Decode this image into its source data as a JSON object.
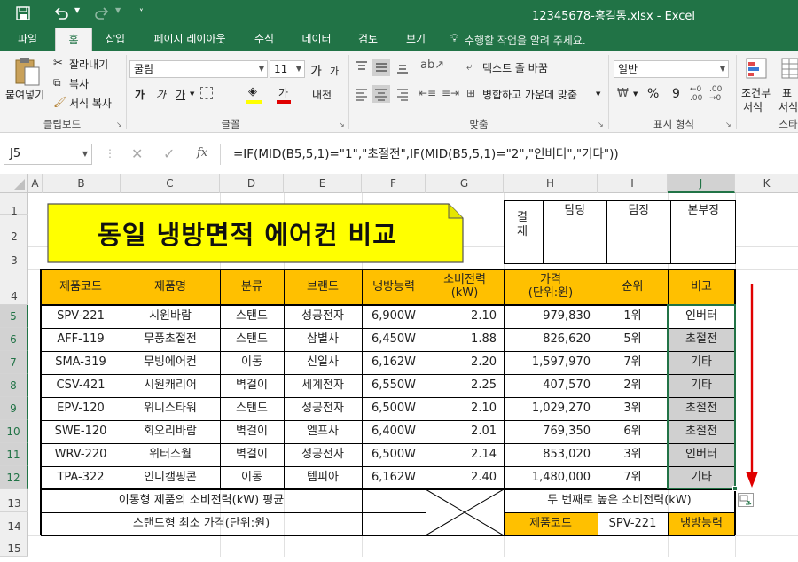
{
  "window": {
    "title": "12345678-홍길동.xlsx - Excel",
    "save_icon": "save-icon",
    "undo_icon": "undo-icon",
    "redo_icon": "redo-icon",
    "customize_icon": "customize-qat-icon"
  },
  "tabs": [
    "파일",
    "홈",
    "삽입",
    "페이지 레이아웃",
    "수식",
    "데이터",
    "검토",
    "보기"
  ],
  "active_tab": "홈",
  "tell_me": "수행할 작업을 알려 주세요.",
  "ribbon": {
    "clipboard": {
      "paste": "붙여넣기",
      "cut": "잘라내기",
      "copy": "복사",
      "format_painter": "서식 복사",
      "label": "클립보드"
    },
    "font": {
      "name": "굴림",
      "size": "11",
      "grow": "가",
      "shrink": "가",
      "bold": "가",
      "italic": "가",
      "underline": "가",
      "fontcolor": "가",
      "phonetic": "내천",
      "label": "글꼴"
    },
    "alignment": {
      "wrap": "텍스트 줄 바꿈",
      "merge": "병합하고 가운데 맞춤",
      "label": "맞춤"
    },
    "number": {
      "format": "일반",
      "percent": "%",
      "comma": "9",
      "label": "표시 형식"
    },
    "styles": {
      "conditional": "조건부",
      "conditional2": "서식",
      "table": "표",
      "table2": "서식",
      "label": "스타"
    }
  },
  "formula_bar": {
    "name_box": "J5",
    "fx": "fx",
    "formula": "=IF(MID(B5,5,1)=\"1\",\"초절전\",IF(MID(B5,5,1)=\"2\",\"인버터\",\"기타\"))"
  },
  "columns": [
    "A",
    "B",
    "C",
    "D",
    "E",
    "F",
    "G",
    "H",
    "I",
    "J",
    "K"
  ],
  "rows": [
    "1",
    "2",
    "3",
    "4",
    "5",
    "6",
    "7",
    "8",
    "9",
    "10",
    "11",
    "12",
    "13",
    "14",
    "15"
  ],
  "sheet": {
    "title": "동일 냉방면적 에어컨 비교",
    "approval": {
      "label": "결재",
      "roles": [
        "담당",
        "팀장",
        "본부장"
      ]
    },
    "headers": [
      "제품코드",
      "제품명",
      "분류",
      "브랜드",
      "냉방능력",
      "소비전력\n(kW)",
      "가격\n(단위:원)",
      "순위",
      "비고"
    ],
    "data": [
      [
        "SPV-221",
        "시원바람",
        "스탠드",
        "성공전자",
        "6,900W",
        "2.10",
        "979,830",
        "1위",
        "인버터"
      ],
      [
        "AFF-119",
        "무풍초절전",
        "스탠드",
        "삼별사",
        "6,450W",
        "1.88",
        "826,620",
        "5위",
        "초절전"
      ],
      [
        "SMA-319",
        "무빙에어컨",
        "이동",
        "신일사",
        "6,162W",
        "2.20",
        "1,597,970",
        "7위",
        "기타"
      ],
      [
        "CSV-421",
        "시원캐리어",
        "벽걸이",
        "세계전자",
        "6,550W",
        "2.25",
        "407,570",
        "2위",
        "기타"
      ],
      [
        "EPV-120",
        "위니스타워",
        "스탠드",
        "성공전자",
        "6,500W",
        "2.10",
        "1,029,270",
        "3위",
        "초절전"
      ],
      [
        "SWE-120",
        "회오리바람",
        "벽걸이",
        "엘프사",
        "6,400W",
        "2.01",
        "769,350",
        "6위",
        "초절전"
      ],
      [
        "WRV-220",
        "위터스월",
        "벽걸이",
        "성공전자",
        "6,500W",
        "2.14",
        "853,020",
        "3위",
        "인버터"
      ],
      [
        "TPA-322",
        "인디캠핑콘",
        "이동",
        "템피아",
        "6,162W",
        "2.40",
        "1,480,000",
        "7위",
        "기타"
      ]
    ],
    "summary": {
      "row13_label": "이동형 제품의 소비전력(kW) 평균",
      "row14_label": "스탠드형 최소 가격(단위:원)",
      "second_highest_label": "두 번째로 높은 소비전력(kW)",
      "code_label": "제품코드",
      "code_value": "SPV-221",
      "cooling_label": "냉방능력"
    }
  },
  "colors": {
    "excel_green": "#217346",
    "header_fill": "#ffc000",
    "title_fill": "#ffff00",
    "selected_fill": "#d0d0d0",
    "arrow": "#e00000"
  }
}
